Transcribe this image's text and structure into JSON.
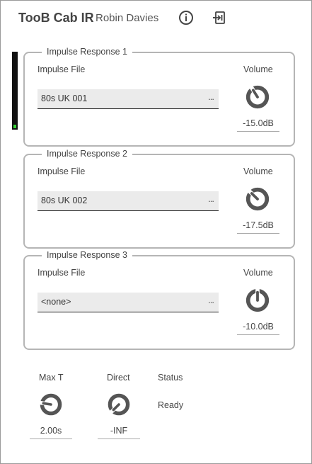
{
  "header": {
    "title": "TooB Cab IR",
    "author": "Robin Davies",
    "info_icon": "info-icon",
    "panel_icon": "panel-export-icon"
  },
  "vu_meter": {
    "level": 0.05,
    "color": "#35d335"
  },
  "impulse_responses": [
    {
      "legend": "Impulse Response 1",
      "file_label": "Impulse File",
      "file_value": "80s UK 001",
      "more": "...",
      "volume_label": "Volume",
      "volume_value": "-15.0dB",
      "knob_level": 0.38
    },
    {
      "legend": "Impulse Response 2",
      "file_label": "Impulse File",
      "file_value": "80s UK 002",
      "more": "...",
      "volume_label": "Volume",
      "volume_value": "-17.5dB",
      "knob_level": 0.33
    },
    {
      "legend": "Impulse Response 3",
      "file_label": "Impulse File",
      "file_value": "<none>",
      "more": "...",
      "volume_label": "Volume",
      "volume_value": "-10.0dB",
      "knob_level": 0.5
    }
  ],
  "controls": {
    "max_t": {
      "label": "Max T",
      "value": "2.00s",
      "knob_level": 0.2
    },
    "direct": {
      "label": "Direct",
      "value": "-INF",
      "knob_level": 0.0
    },
    "status": {
      "label": "Status",
      "value": "Ready"
    }
  },
  "colors": {
    "knob": "#555555",
    "field_bg": "#ebebeb",
    "border": "#b5b5b5"
  }
}
